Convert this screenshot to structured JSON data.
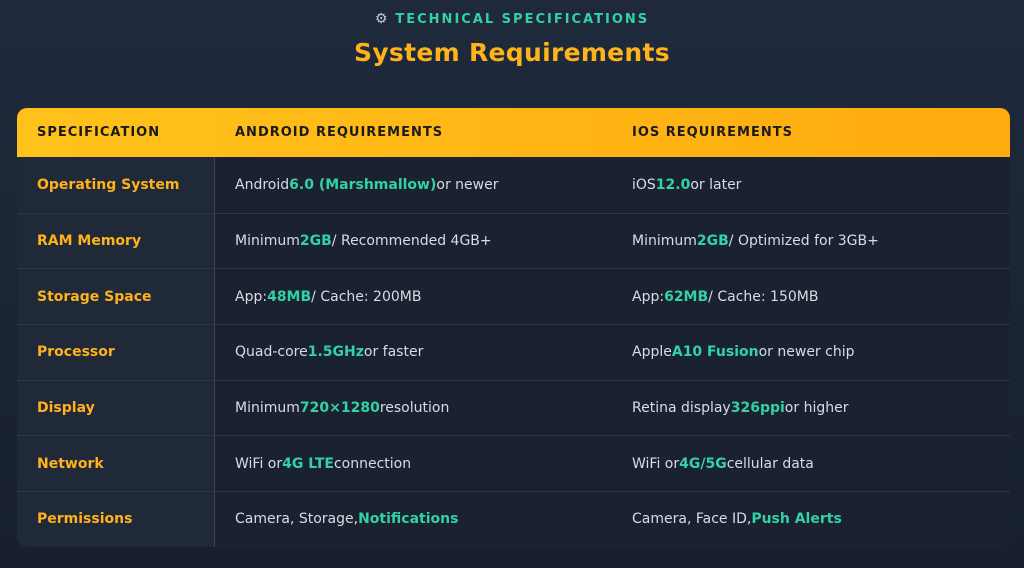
{
  "header": {
    "kicker_icon": "gear-icon",
    "kicker": "TECHNICAL SPECIFICATIONS",
    "title": "System Requirements"
  },
  "table": {
    "columns": [
      "SPECIFICATION",
      "ANDROID REQUIREMENTS",
      "IOS REQUIREMENTS"
    ],
    "rows": [
      {
        "spec": "Operating System",
        "android": {
          "pre": "Android",
          "hl": "6.0 (Marshmallow)",
          "post": "or newer"
        },
        "ios": {
          "pre": "iOS",
          "hl": "12.0",
          "post": "or later"
        }
      },
      {
        "spec": "RAM Memory",
        "android": {
          "pre": "Minimum",
          "hl": "2GB",
          "post": "/ Recommended 4GB+"
        },
        "ios": {
          "pre": "Minimum",
          "hl": "2GB",
          "post": "/ Optimized for 3GB+"
        }
      },
      {
        "spec": "Storage Space",
        "android": {
          "pre": "App:",
          "hl": "48MB",
          "post": "/ Cache: 200MB"
        },
        "ios": {
          "pre": "App:",
          "hl": "62MB",
          "post": "/ Cache: 150MB"
        }
      },
      {
        "spec": "Processor",
        "android": {
          "pre": "Quad-core",
          "hl": "1.5GHz",
          "post": "or faster"
        },
        "ios": {
          "pre": "Apple",
          "hl": "A10 Fusion",
          "post": "or newer chip"
        }
      },
      {
        "spec": "Display",
        "android": {
          "pre": "Minimum",
          "hl": "720×1280",
          "post": "resolution"
        },
        "ios": {
          "pre": "Retina display",
          "hl": "326ppi",
          "post": "or higher"
        }
      },
      {
        "spec": "Network",
        "android": {
          "pre": "WiFi or",
          "hl": "4G LTE",
          "post": "connection"
        },
        "ios": {
          "pre": "WiFi or",
          "hl": "4G/5G",
          "post": "cellular data"
        }
      },
      {
        "spec": "Permissions",
        "android": {
          "pre": "Camera, Storage,",
          "hl": "Notifications",
          "post": ""
        },
        "ios": {
          "pre": "Camera, Face ID,",
          "hl": "Push Alerts",
          "post": ""
        }
      }
    ]
  }
}
